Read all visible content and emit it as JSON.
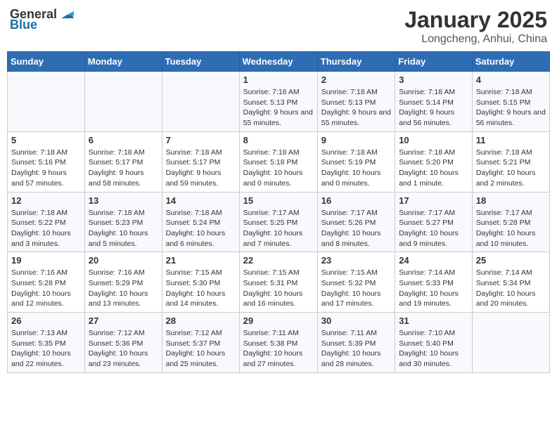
{
  "header": {
    "logo_general": "General",
    "logo_blue": "Blue",
    "month_title": "January 2025",
    "location": "Longcheng, Anhui, China"
  },
  "days_of_week": [
    "Sunday",
    "Monday",
    "Tuesday",
    "Wednesday",
    "Thursday",
    "Friday",
    "Saturday"
  ],
  "weeks": [
    [
      {
        "day": "",
        "info": ""
      },
      {
        "day": "",
        "info": ""
      },
      {
        "day": "",
        "info": ""
      },
      {
        "day": "1",
        "info": "Sunrise: 7:18 AM\nSunset: 5:13 PM\nDaylight: 9 hours\nand 55 minutes."
      },
      {
        "day": "2",
        "info": "Sunrise: 7:18 AM\nSunset: 5:13 PM\nDaylight: 9 hours\nand 55 minutes."
      },
      {
        "day": "3",
        "info": "Sunrise: 7:18 AM\nSunset: 5:14 PM\nDaylight: 9 hours\nand 56 minutes."
      },
      {
        "day": "4",
        "info": "Sunrise: 7:18 AM\nSunset: 5:15 PM\nDaylight: 9 hours\nand 56 minutes."
      }
    ],
    [
      {
        "day": "5",
        "info": "Sunrise: 7:18 AM\nSunset: 5:16 PM\nDaylight: 9 hours\nand 57 minutes."
      },
      {
        "day": "6",
        "info": "Sunrise: 7:18 AM\nSunset: 5:17 PM\nDaylight: 9 hours\nand 58 minutes."
      },
      {
        "day": "7",
        "info": "Sunrise: 7:18 AM\nSunset: 5:17 PM\nDaylight: 9 hours\nand 59 minutes."
      },
      {
        "day": "8",
        "info": "Sunrise: 7:18 AM\nSunset: 5:18 PM\nDaylight: 10 hours\nand 0 minutes."
      },
      {
        "day": "9",
        "info": "Sunrise: 7:18 AM\nSunset: 5:19 PM\nDaylight: 10 hours\nand 0 minutes."
      },
      {
        "day": "10",
        "info": "Sunrise: 7:18 AM\nSunset: 5:20 PM\nDaylight: 10 hours\nand 1 minute."
      },
      {
        "day": "11",
        "info": "Sunrise: 7:18 AM\nSunset: 5:21 PM\nDaylight: 10 hours\nand 2 minutes."
      }
    ],
    [
      {
        "day": "12",
        "info": "Sunrise: 7:18 AM\nSunset: 5:22 PM\nDaylight: 10 hours\nand 3 minutes."
      },
      {
        "day": "13",
        "info": "Sunrise: 7:18 AM\nSunset: 5:23 PM\nDaylight: 10 hours\nand 5 minutes."
      },
      {
        "day": "14",
        "info": "Sunrise: 7:18 AM\nSunset: 5:24 PM\nDaylight: 10 hours\nand 6 minutes."
      },
      {
        "day": "15",
        "info": "Sunrise: 7:17 AM\nSunset: 5:25 PM\nDaylight: 10 hours\nand 7 minutes."
      },
      {
        "day": "16",
        "info": "Sunrise: 7:17 AM\nSunset: 5:26 PM\nDaylight: 10 hours\nand 8 minutes."
      },
      {
        "day": "17",
        "info": "Sunrise: 7:17 AM\nSunset: 5:27 PM\nDaylight: 10 hours\nand 9 minutes."
      },
      {
        "day": "18",
        "info": "Sunrise: 7:17 AM\nSunset: 5:28 PM\nDaylight: 10 hours\nand 10 minutes."
      }
    ],
    [
      {
        "day": "19",
        "info": "Sunrise: 7:16 AM\nSunset: 5:28 PM\nDaylight: 10 hours\nand 12 minutes."
      },
      {
        "day": "20",
        "info": "Sunrise: 7:16 AM\nSunset: 5:29 PM\nDaylight: 10 hours\nand 13 minutes."
      },
      {
        "day": "21",
        "info": "Sunrise: 7:15 AM\nSunset: 5:30 PM\nDaylight: 10 hours\nand 14 minutes."
      },
      {
        "day": "22",
        "info": "Sunrise: 7:15 AM\nSunset: 5:31 PM\nDaylight: 10 hours\nand 16 minutes."
      },
      {
        "day": "23",
        "info": "Sunrise: 7:15 AM\nSunset: 5:32 PM\nDaylight: 10 hours\nand 17 minutes."
      },
      {
        "day": "24",
        "info": "Sunrise: 7:14 AM\nSunset: 5:33 PM\nDaylight: 10 hours\nand 19 minutes."
      },
      {
        "day": "25",
        "info": "Sunrise: 7:14 AM\nSunset: 5:34 PM\nDaylight: 10 hours\nand 20 minutes."
      }
    ],
    [
      {
        "day": "26",
        "info": "Sunrise: 7:13 AM\nSunset: 5:35 PM\nDaylight: 10 hours\nand 22 minutes."
      },
      {
        "day": "27",
        "info": "Sunrise: 7:12 AM\nSunset: 5:36 PM\nDaylight: 10 hours\nand 23 minutes."
      },
      {
        "day": "28",
        "info": "Sunrise: 7:12 AM\nSunset: 5:37 PM\nDaylight: 10 hours\nand 25 minutes."
      },
      {
        "day": "29",
        "info": "Sunrise: 7:11 AM\nSunset: 5:38 PM\nDaylight: 10 hours\nand 27 minutes."
      },
      {
        "day": "30",
        "info": "Sunrise: 7:11 AM\nSunset: 5:39 PM\nDaylight: 10 hours\nand 28 minutes."
      },
      {
        "day": "31",
        "info": "Sunrise: 7:10 AM\nSunset: 5:40 PM\nDaylight: 10 hours\nand 30 minutes."
      },
      {
        "day": "",
        "info": ""
      }
    ]
  ]
}
